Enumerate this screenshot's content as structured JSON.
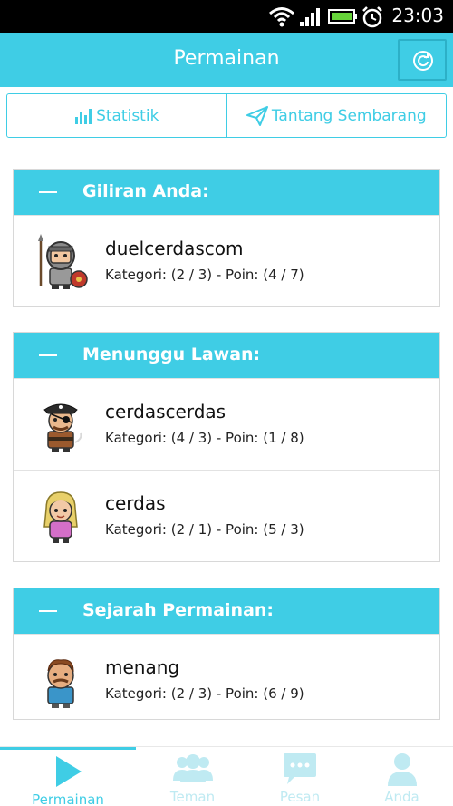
{
  "statusbar": {
    "time": "23:03"
  },
  "actionbar": {
    "title": "Permainan"
  },
  "segtabs": [
    {
      "label": "Statistik",
      "icon": "bar-chart-icon"
    },
    {
      "label": "Tantang Sembarang",
      "icon": "paper-plane-icon"
    }
  ],
  "sections": [
    {
      "title": "Giliran Anda:",
      "rows": [
        {
          "name": "duelcerdascom",
          "meta": "Kategori: (2 / 3) - Poin: (4 / 7)",
          "avatar": "knight-avatar"
        }
      ]
    },
    {
      "title": "Menunggu Lawan:",
      "rows": [
        {
          "name": "cerdascerdas",
          "meta": "Kategori: (4 / 3) - Poin: (1 / 8)",
          "avatar": "pirate-avatar"
        },
        {
          "name": "cerdas",
          "meta": "Kategori: (2 / 1) - Poin: (5 / 3)",
          "avatar": "girl-avatar"
        }
      ]
    },
    {
      "title": "Sejarah Permainan:",
      "rows": [
        {
          "name": "menang",
          "meta": "Kategori: (2 / 3) - Poin: (6 / 9)",
          "avatar": "man-avatar"
        }
      ]
    }
  ],
  "bottomnav": [
    {
      "label": "Permainan",
      "icon": "play-icon",
      "active": true
    },
    {
      "label": "Teman",
      "icon": "group-icon",
      "active": false
    },
    {
      "label": "Pesan",
      "icon": "chat-bubble-icon",
      "active": false
    },
    {
      "label": "Anda",
      "icon": "user-icon",
      "active": false
    }
  ],
  "colors": {
    "accent": "#3fcde5",
    "inactive": "#bfeaf2"
  }
}
